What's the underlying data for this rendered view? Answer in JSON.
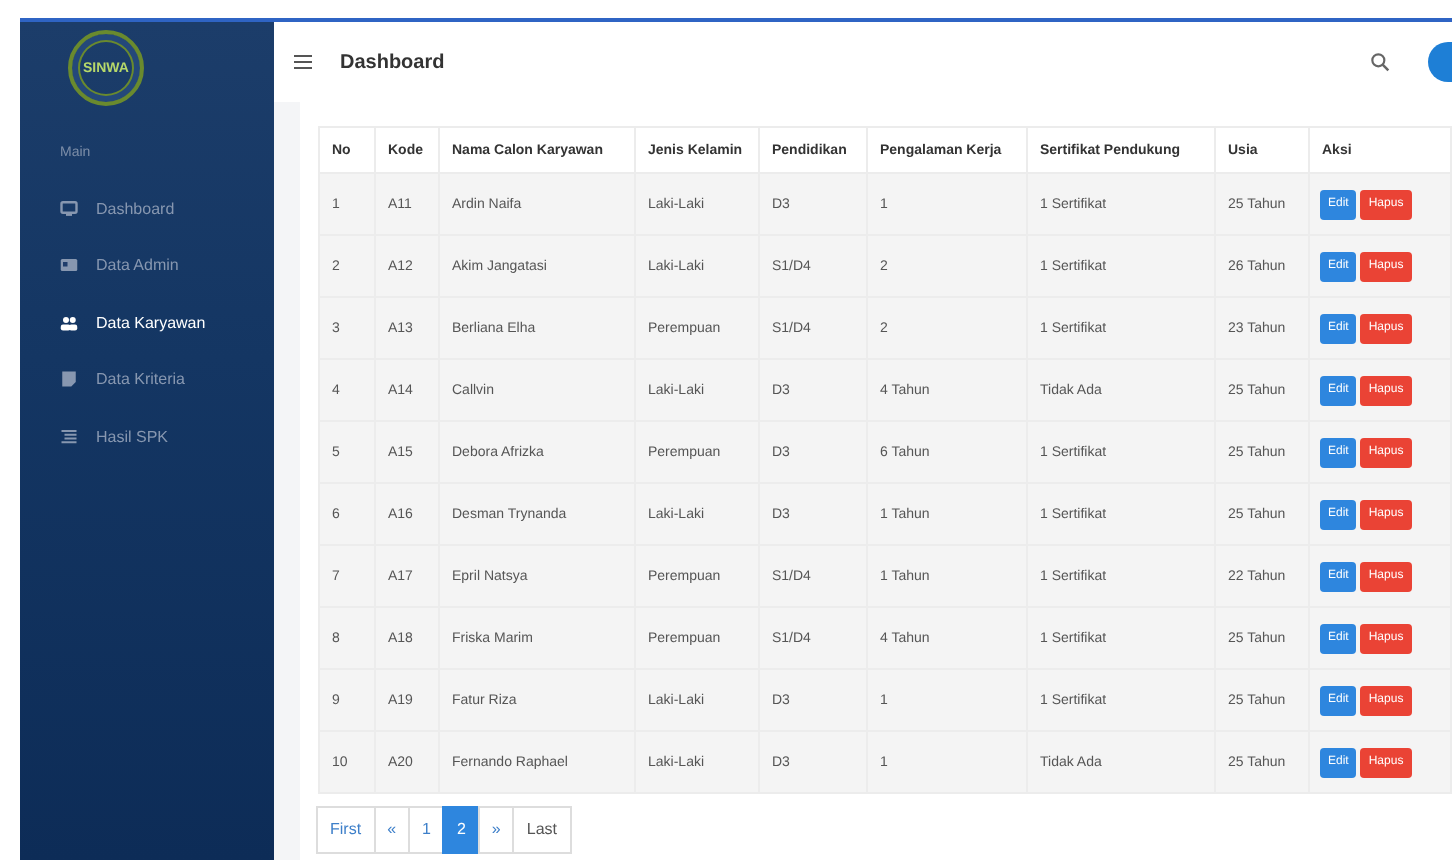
{
  "logo": {
    "text": "SINWA"
  },
  "sidebar": {
    "section": "Main",
    "items": [
      {
        "label": "Dashboard",
        "selected": false
      },
      {
        "label": "Data Admin",
        "selected": false
      },
      {
        "label": "Data Karyawan",
        "selected": true
      },
      {
        "label": "Data Kriteria",
        "selected": false
      },
      {
        "label": "Hasil SPK",
        "selected": false
      }
    ]
  },
  "header": {
    "title": "Dashboard"
  },
  "table": {
    "columns": [
      "No",
      "Kode",
      "Nama Calon Karyawan",
      "Jenis Kelamin",
      "Pendidikan",
      "Pengalaman Kerja",
      "Sertifikat Pendukung",
      "Usia",
      "Aksi"
    ],
    "rows": [
      {
        "cells": [
          "1",
          "A11",
          "Ardin Naifa",
          "Laki-Laki",
          "D3",
          "1",
          "1 Sertifikat",
          "25 Tahun"
        ],
        "actions": [
          "Edit",
          "Hapus"
        ]
      },
      {
        "cells": [
          "2",
          "A12",
          "Akim Jangatasi",
          "Laki-Laki",
          "S1/D4",
          "2",
          "1 Sertifikat",
          "26 Tahun"
        ],
        "actions": [
          "Edit",
          "Hapus"
        ]
      },
      {
        "cells": [
          "3",
          "A13",
          "Berliana Elha",
          "Perempuan",
          "S1/D4",
          "2",
          "1 Sertifikat",
          "23 Tahun"
        ],
        "actions": [
          "Edit",
          "Hapus"
        ]
      },
      {
        "cells": [
          "4",
          "A14",
          "Callvin",
          "Laki-Laki",
          "D3",
          "4 Tahun",
          "Tidak Ada",
          "25 Tahun"
        ],
        "actions": [
          "Edit",
          "Hapus"
        ]
      },
      {
        "cells": [
          "5",
          "A15",
          "Debora Afrizka",
          "Perempuan",
          "D3",
          "6 Tahun",
          "1 Sertifikat",
          "25 Tahun"
        ],
        "actions": [
          "Edit",
          "Hapus"
        ]
      },
      {
        "cells": [
          "6",
          "A16",
          "Desman Trynanda",
          "Laki-Laki",
          "D3",
          "1 Tahun",
          "1 Sertifikat",
          "25 Tahun"
        ],
        "actions": [
          "Edit",
          "Hapus"
        ]
      },
      {
        "cells": [
          "7",
          "A17",
          "Epril Natsya",
          "Perempuan",
          "S1/D4",
          "1 Tahun",
          "1 Sertifikat",
          "22 Tahun"
        ],
        "actions": [
          "Edit",
          "Hapus"
        ]
      },
      {
        "cells": [
          "8",
          "A18",
          "Friska Marim",
          "Perempuan",
          "S1/D4",
          "4 Tahun",
          "1 Sertifikat",
          "25 Tahun"
        ],
        "actions": [
          "Edit",
          "Hapus"
        ]
      },
      {
        "cells": [
          "9",
          "A19",
          "Fatur Riza",
          "Laki-Laki",
          "D3",
          "1",
          "1 Sertifikat",
          "25 Tahun"
        ],
        "actions": [
          "Edit",
          "Hapus"
        ]
      },
      {
        "cells": [
          "10",
          "A20",
          "Fernando Raphael",
          "Laki-Laki",
          "D3",
          "1",
          "Tidak Ada",
          "25 Tahun"
        ],
        "actions": [
          "Edit",
          "Hapus"
        ]
      }
    ]
  },
  "pagination": [
    {
      "label": "First",
      "selected": false
    },
    {
      "label": "«",
      "selected": false
    },
    {
      "label": "1",
      "selected": false
    },
    {
      "label": "2",
      "selected": true
    },
    {
      "label": "»",
      "selected": false
    },
    {
      "label": "Last",
      "selected": false
    }
  ]
}
